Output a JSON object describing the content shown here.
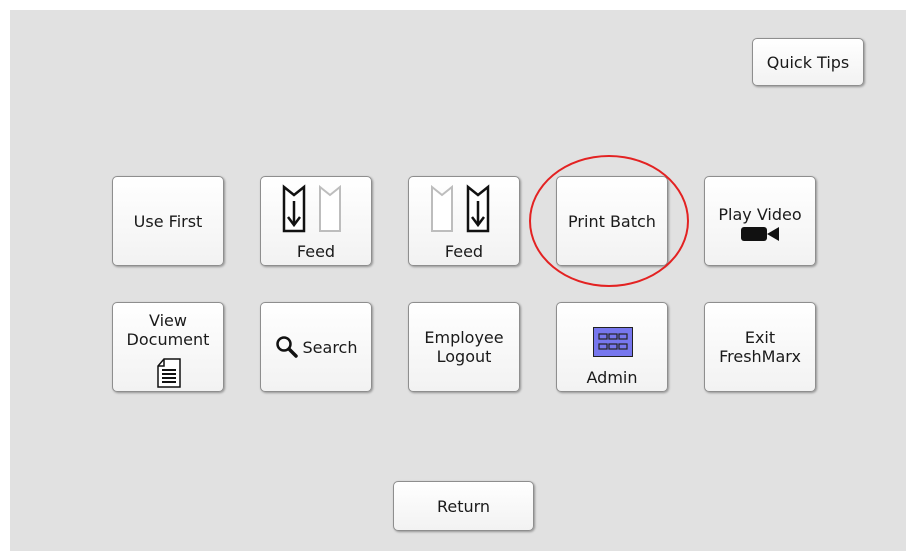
{
  "header": {
    "quick_tips_label": "Quick Tips"
  },
  "row1": {
    "use_first_label": "Use First",
    "feed_left_label": "Feed",
    "feed_right_label": "Feed",
    "print_batch_label": "Print Batch",
    "play_video_label": "Play Video"
  },
  "row2": {
    "view_document_line1": "View",
    "view_document_line2": "Document",
    "search_label": "Search",
    "employee_logout_line1": "Employee",
    "employee_logout_line2": "Logout",
    "admin_label": "Admin",
    "exit_line1": "Exit",
    "exit_line2": "FreshMarx"
  },
  "footer": {
    "return_label": "Return"
  },
  "colors": {
    "panel_bg": "#e1e1e1",
    "highlight_circle": "#e32222",
    "admin_icon": "#7777ee"
  },
  "icons": {
    "feed_left": "label-feed-left-icon",
    "feed_right": "label-feed-right-icon",
    "video": "video-camera-icon",
    "document": "document-icon",
    "search": "magnifier-icon",
    "admin": "admin-grid-icon"
  }
}
